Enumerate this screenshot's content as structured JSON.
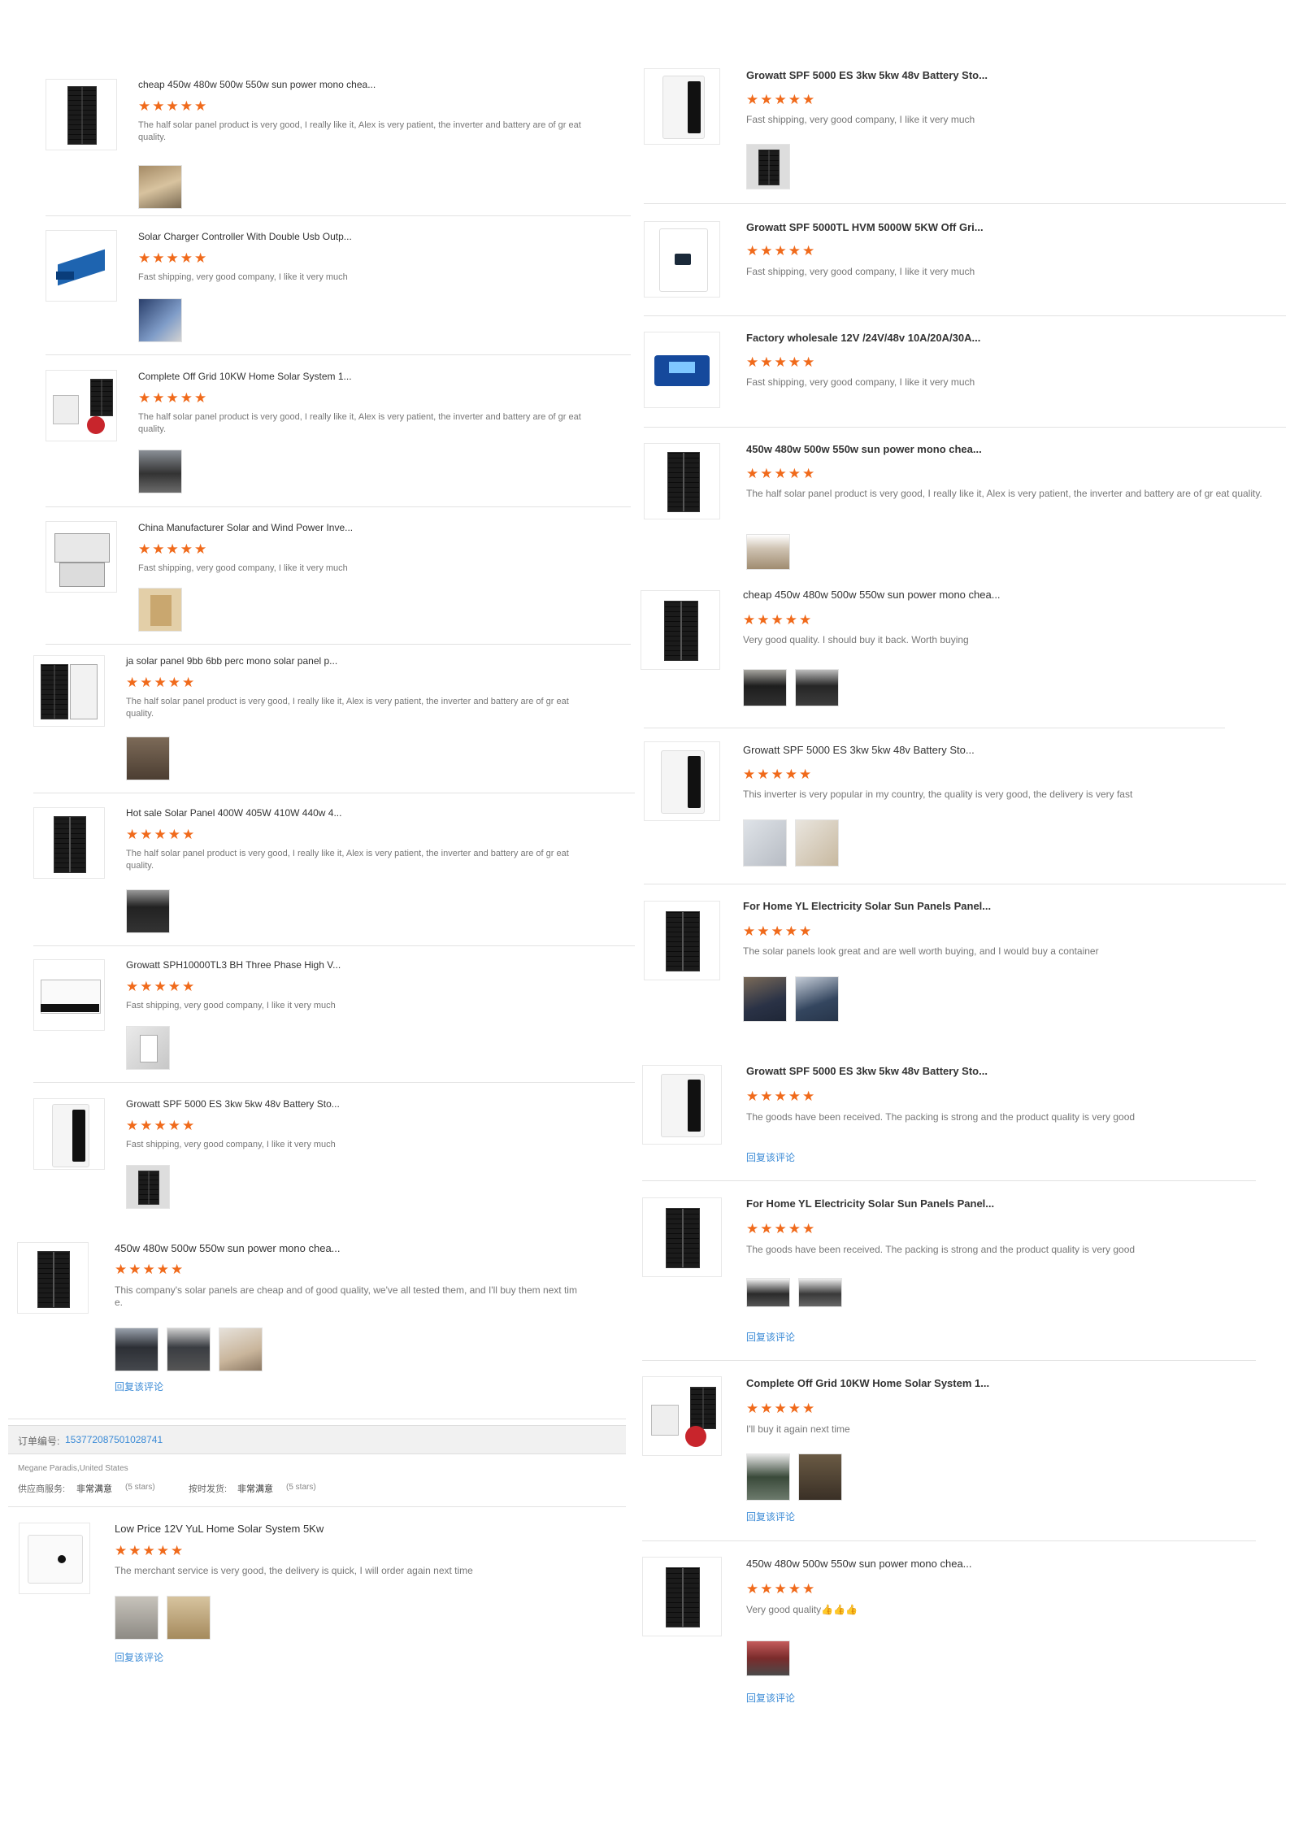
{
  "left_reviews": [
    {
      "title": "cheap 450w 480w 500w 550w sun power mono chea...",
      "stars": "★★★★★",
      "text": "The half solar panel product is very good, I really like it, Alex is very patient, the inverter and battery are of gr eat quality.",
      "reply": ""
    },
    {
      "title": "Solar Charger Controller With Double Usb Outp...",
      "stars": "★★★★★",
      "text": "Fast shipping, very good company, I like it very much",
      "reply": ""
    },
    {
      "title": "Complete Off Grid 10KW Home Solar System 1...",
      "stars": "★★★★★",
      "text": "The half solar panel product is very good, I really like it, Alex is very patient, the inverter and battery are of gr eat quality.",
      "reply": ""
    },
    {
      "title": "China Manufacturer Solar and Wind Power Inve...",
      "stars": "★★★★★",
      "text": "Fast shipping, very good company, I like it very much",
      "reply": ""
    },
    {
      "title": "ja solar panel 9bb 6bb perc mono solar panel p...",
      "stars": "★★★★★",
      "text": "The half solar panel product is very good, I really like it, Alex is very patient, the inverter and battery are of gr eat quality.",
      "reply": ""
    },
    {
      "title": "Hot sale Solar Panel 400W 405W 410W 440w 4...",
      "stars": "★★★★★",
      "text": "The half solar panel product is very good, I really like it, Alex is very patient, the inverter and battery are of gr eat quality.",
      "reply": ""
    },
    {
      "title": "Growatt SPH10000TL3 BH Three Phase High V...",
      "stars": "★★★★★",
      "text": "Fast shipping, very good company, I like it very much",
      "reply": ""
    },
    {
      "title": "Growatt SPF 5000 ES 3kw 5kw 48v Battery Sto...",
      "stars": "★★★★★",
      "text": "Fast shipping, very good company, I like it very much",
      "reply": ""
    },
    {
      "title": "450w 480w 500w 550w sun power mono chea...",
      "stars": "★★★★★",
      "text": "This company's solar panels are cheap and of good quality, we've all tested them, and I'll buy them next tim e.",
      "reply": "回复该评论"
    },
    {
      "title": "Low Price 12V YuL Home Solar System 5Kw",
      "stars": "★★★★★",
      "text": "The merchant service is very good, the delivery is quick, I will order again next time",
      "reply": "回复该评论"
    }
  ],
  "right_reviews": [
    {
      "title": "Growatt SPF 5000 ES 3kw 5kw 48v Battery Sto...",
      "stars": "★★★★★",
      "text": "Fast shipping, very good company, I like it very much",
      "reply": ""
    },
    {
      "title": "Growatt SPF 5000TL HVM 5000W 5KW Off Gri...",
      "stars": "★★★★★",
      "text": "Fast shipping, very good company, I like it very much",
      "reply": ""
    },
    {
      "title": "Factory wholesale 12V /24V/48v 10A/20A/30A...",
      "stars": "★★★★★",
      "text": "Fast shipping, very good company, I like it very much",
      "reply": ""
    },
    {
      "title": "450w 480w 500w 550w sun power mono chea...",
      "stars": "★★★★★",
      "text": "The half solar panel product is very good, I really like it, Alex is very patient, the inverter and battery are of gr eat quality.",
      "reply": ""
    },
    {
      "title": "cheap 450w 480w 500w 550w sun power mono chea...",
      "stars": "★★★★★",
      "text": "Very good quality. I should buy it back. Worth buying",
      "reply": ""
    },
    {
      "title": "Growatt SPF 5000 ES 3kw 5kw 48v Battery Sto...",
      "stars": "★★★★★",
      "text": "This inverter is very popular in my country, the quality is very good, the delivery is very fast",
      "reply": ""
    },
    {
      "title": "For Home YL Electricity Solar Sun Panels Panel...",
      "stars": "★★★★★",
      "text": "The solar panels look great and are well worth buying, and I would buy a container",
      "reply": ""
    },
    {
      "title": "Growatt SPF 5000 ES 3kw 5kw 48v Battery Sto...",
      "stars": "★★★★★",
      "text": "The goods have been received. The packing is strong and the product quality is very good",
      "reply": "回复该评论"
    },
    {
      "title": "For Home YL Electricity Solar Sun Panels Panel...",
      "stars": "★★★★★",
      "text": "The goods have been received. The packing is strong and the product quality is very good",
      "reply": "回复该评论"
    },
    {
      "title": "Complete Off Grid 10KW Home Solar System 1...",
      "stars": "★★★★★",
      "text": "I'll buy it again next time",
      "reply": "回复该评论"
    },
    {
      "title": "450w 480w 500w 550w sun power mono chea...",
      "stars": "★★★★★",
      "text": "Very good quality👍👍👍",
      "reply": "回复该评论"
    }
  ],
  "order": {
    "label": "订单编号:",
    "number": "153772087501028741",
    "buyer": "Megane Paradis,United States",
    "supplier_label": "供应商服务:",
    "supplier_value": "非常满意",
    "supplier_stars": "(5 stars)",
    "ontime_label": "按时发货:",
    "ontime_value": "非常满意",
    "ontime_stars": "(5 stars)"
  },
  "colors": {
    "star": "#f06a1b",
    "link": "#3a8ad6"
  }
}
